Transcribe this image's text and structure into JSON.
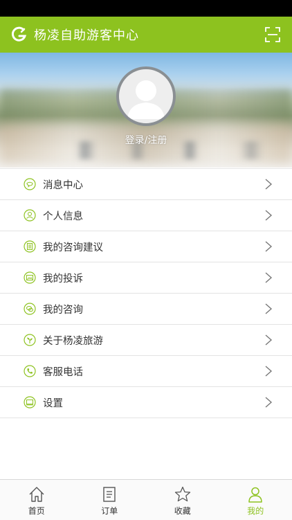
{
  "header": {
    "title": "杨凌自助游客中心"
  },
  "profile": {
    "login_label": "登录/注册"
  },
  "menu": [
    {
      "label": "消息中心",
      "icon": "message-icon"
    },
    {
      "label": "个人信息",
      "icon": "user-icon"
    },
    {
      "label": "我的咨询建议",
      "icon": "document-icon"
    },
    {
      "label": "我的投诉",
      "icon": "complaint-icon"
    },
    {
      "label": "我的咨询",
      "icon": "chat-icon"
    },
    {
      "label": "关于杨凌旅游",
      "icon": "plant-icon"
    },
    {
      "label": "客服电话",
      "icon": "phone-icon"
    },
    {
      "label": "设置",
      "icon": "settings-icon"
    }
  ],
  "tabs": [
    {
      "label": "首页",
      "icon": "home-icon"
    },
    {
      "label": "订单",
      "icon": "order-icon"
    },
    {
      "label": "收藏",
      "icon": "star-icon"
    },
    {
      "label": "我的",
      "icon": "profile-icon"
    }
  ],
  "colors": {
    "accent": "#8dc21f"
  }
}
